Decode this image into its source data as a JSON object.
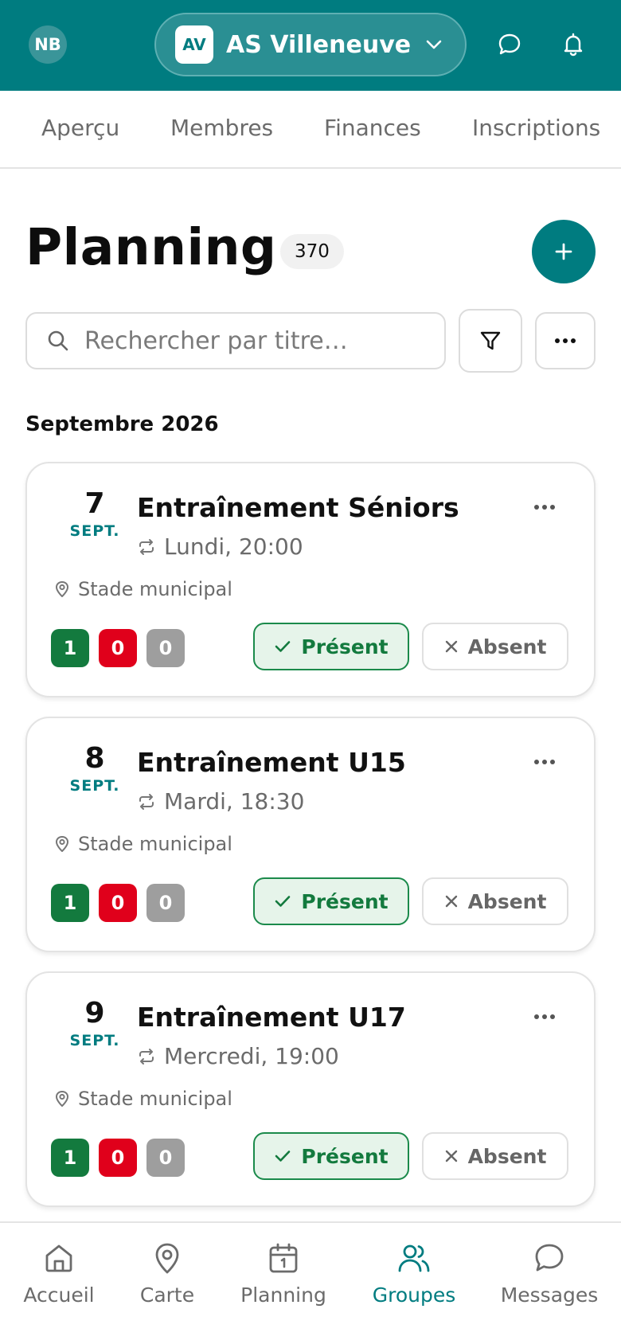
{
  "header": {
    "user_initials": "NB",
    "org_badge": "AV",
    "org_name": "AS Villeneuve",
    "icons": [
      "chat-icon",
      "bell-icon",
      "chevron-down-icon"
    ]
  },
  "tabs": [
    {
      "label": "Aperçu"
    },
    {
      "label": "Membres"
    },
    {
      "label": "Finances"
    },
    {
      "label": "Inscriptions"
    }
  ],
  "page": {
    "title": "Planning",
    "count": "370",
    "search_placeholder": "Rechercher par titre…"
  },
  "month_heading": "Septembre 2026",
  "events": [
    {
      "day": "7",
      "month": "SEPT.",
      "title": "Entraînement Séniors",
      "schedule": "Lundi, 20:00",
      "location": "Stade municipal",
      "present_count": "1",
      "absent_count": "0",
      "pending_count": "0",
      "present_label": "Présent",
      "absent_label": "Absent"
    },
    {
      "day": "8",
      "month": "SEPT.",
      "title": "Entraînement U15",
      "schedule": "Mardi, 18:30",
      "location": "Stade municipal",
      "present_count": "1",
      "absent_count": "0",
      "pending_count": "0",
      "present_label": "Présent",
      "absent_label": "Absent"
    },
    {
      "day": "9",
      "month": "SEPT.",
      "title": "Entraînement U17",
      "schedule": "Mercredi, 19:00",
      "location": "Stade municipal",
      "present_count": "1",
      "absent_count": "0",
      "pending_count": "0",
      "present_label": "Présent",
      "absent_label": "Absent"
    }
  ],
  "colors": {
    "brand": "#007c80",
    "present": "#137a3e",
    "absent": "#e0001b",
    "pending": "#9e9e9e"
  },
  "bottom_nav": [
    {
      "label": "Accueil",
      "icon": "home-icon",
      "active": false
    },
    {
      "label": "Carte",
      "icon": "map-pin-icon",
      "active": false
    },
    {
      "label": "Planning",
      "icon": "calendar-icon",
      "active": false
    },
    {
      "label": "Groupes",
      "icon": "users-icon",
      "active": true
    },
    {
      "label": "Messages",
      "icon": "chat-icon",
      "active": false
    }
  ]
}
